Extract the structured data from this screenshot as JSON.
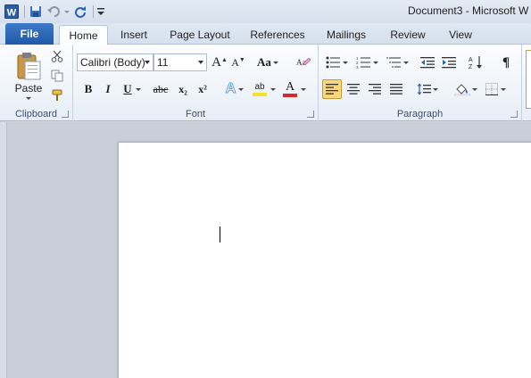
{
  "window": {
    "title": "Document3 - Microsoft W"
  },
  "tabs": {
    "file": "File",
    "items": [
      "Home",
      "Insert",
      "Page Layout",
      "References",
      "Mailings",
      "Review",
      "View"
    ]
  },
  "clipboard": {
    "paste_label": "Paste",
    "group_label": "Clipboard"
  },
  "font": {
    "family": "Calibri (Body)",
    "size": "11",
    "grow": "A",
    "shrink": "A",
    "case": "Aa",
    "bold": "B",
    "italic": "I",
    "underline": "U",
    "strike": "abc",
    "subscript": "x₂",
    "superscript": "x²",
    "effects": "A",
    "highlight": "ab",
    "color": "A",
    "group_label": "Font"
  },
  "paragraph": {
    "pilcrow": "¶",
    "group_label": "Paragraph"
  },
  "colors": {
    "file_tab": "#2a63b3",
    "highlight_yellow": "#f5e12a",
    "font_red": "#d42a2a",
    "align_active": "#fbd77d",
    "effects_blue": "#5aa4e0"
  }
}
